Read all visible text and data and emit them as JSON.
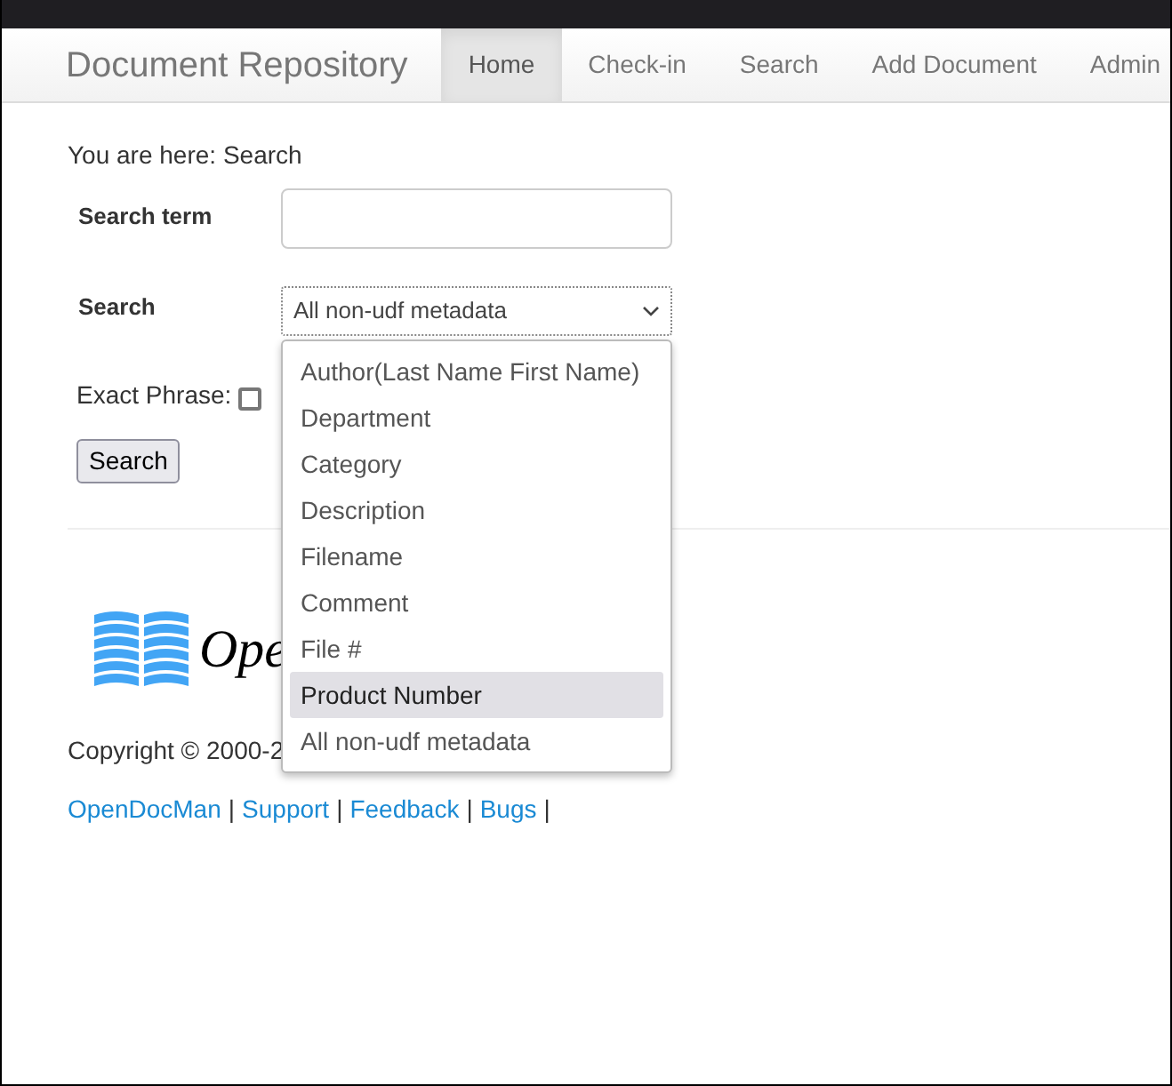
{
  "navbar": {
    "brand": "Document Repository",
    "items": [
      {
        "label": "Home",
        "selected": true
      },
      {
        "label": "Check-in",
        "selected": false
      },
      {
        "label": "Search",
        "selected": false
      },
      {
        "label": "Add Document",
        "selected": false
      },
      {
        "label": "Admin",
        "selected": false
      }
    ]
  },
  "breadcrumb": "You are here: Search",
  "form": {
    "term_label": "Search term",
    "search_label": "Search",
    "select_value": "All non-udf metadata",
    "options": [
      {
        "label": "Author(Last Name First Name)",
        "selected": false
      },
      {
        "label": "Department",
        "selected": false
      },
      {
        "label": "Category",
        "selected": false
      },
      {
        "label": "Description",
        "selected": false
      },
      {
        "label": "Filename",
        "selected": false
      },
      {
        "label": "Comment",
        "selected": false
      },
      {
        "label": "File #",
        "selected": false
      },
      {
        "label": "Product Number",
        "selected": true
      },
      {
        "label": "All non-udf metadata",
        "selected": false
      }
    ],
    "exact_label": "Exact Phrase:",
    "exact_checked": false,
    "button": "Search"
  },
  "footer": {
    "logo_text": "Ope",
    "copyright": "Copyright © 2000-2",
    "links": [
      "OpenDocMan",
      "Support",
      "Feedback",
      "Bugs"
    ],
    "separator": "|"
  }
}
